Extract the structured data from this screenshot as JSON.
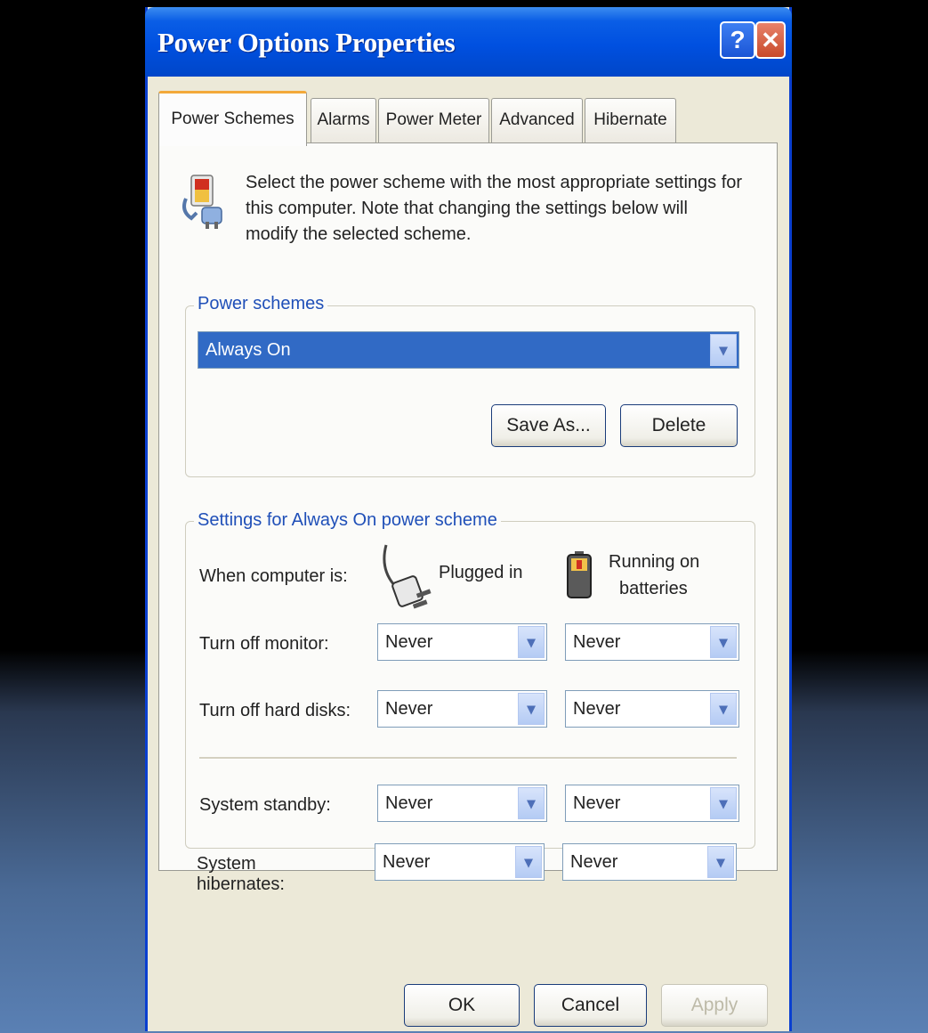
{
  "window": {
    "title": "Power Options Properties",
    "help_glyph": "?",
    "close_glyph": "✕"
  },
  "tabs": [
    {
      "label": "Power Schemes",
      "active": true
    },
    {
      "label": "Alarms",
      "active": false
    },
    {
      "label": "Power Meter",
      "active": false
    },
    {
      "label": "Advanced",
      "active": false
    },
    {
      "label": "Hibernate",
      "active": false
    }
  ],
  "intro": {
    "text": "Select the power scheme with the most appropriate settings for this computer. Note that changing the settings below will modify the selected scheme.",
    "icon": "power-options-icon"
  },
  "schemes": {
    "group_label": "Power schemes",
    "selected": "Always On",
    "save_as_label": "Save As...",
    "delete_label": "Delete"
  },
  "settings": {
    "group_label": "Settings for Always On power scheme",
    "when_label": "When computer is:",
    "plugged_label": "Plugged in",
    "battery_label_1": "Running on",
    "battery_label_2": "batteries",
    "rows": [
      {
        "label": "Turn off monitor:",
        "plugged": "Never",
        "battery": "Never"
      },
      {
        "label": "Turn off hard disks:",
        "plugged": "Never",
        "battery": "Never"
      },
      {
        "label": "System standby:",
        "plugged": "Never",
        "battery": "Never"
      },
      {
        "label": "System hibernates:",
        "plugged": "Never",
        "battery": "Never"
      }
    ]
  },
  "footer": {
    "ok_label": "OK",
    "cancel_label": "Cancel",
    "apply_label": "Apply"
  },
  "colors": {
    "title_bar": "#0050e0",
    "selection": "#316ac5",
    "group_label": "#1f4fb8"
  }
}
